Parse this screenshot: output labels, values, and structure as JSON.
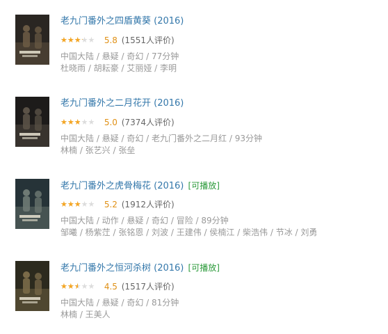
{
  "items": [
    {
      "title": "老九门番外之四盾黄葵 (2016)",
      "playable": "",
      "rating": 5.8,
      "rating_label": "5.8",
      "votes_label": "(1551人评价)",
      "meta": "中国大陆 / 悬疑 / 奇幻 / 77分钟",
      "cast": "杜晓雨 / 胡耘豪 / 艾丽娅 / 李明",
      "poster_palette": [
        "#2a2622",
        "#6a5a44"
      ]
    },
    {
      "title": "老九门番外之二月花开 (2016)",
      "playable": "",
      "rating": 5.0,
      "rating_label": "5.0",
      "votes_label": "(7374人评价)",
      "meta": "中国大陆 / 悬疑 / 奇幻 / 老九门番外之二月红 / 93分钟",
      "cast": "林楠 / 张艺兴 / 张垒",
      "poster_palette": [
        "#1d1b1a",
        "#5b5247"
      ]
    },
    {
      "title": "老九门番外之虎骨梅花 (2016)",
      "playable": "[可播放]",
      "rating": 5.2,
      "rating_label": "5.2",
      "votes_label": "(1912人评价)",
      "meta": "中国大陆 / 动作 / 悬疑 / 奇幻 / 冒险 / 89分钟",
      "cast": "邹曦 / 杨紫茳 / 张铭恩 / 刘波 / 王建伟 / 侯楠江 / 柴浩伟 / 节冰 / 刘勇",
      "poster_palette": [
        "#263338",
        "#6f7a74"
      ]
    },
    {
      "title": "老九门番外之恒河杀树 (2016)",
      "playable": "[可播放]",
      "rating": 4.5,
      "rating_label": "4.5",
      "votes_label": "(1517人评价)",
      "meta": "中国大陆 / 悬疑 / 奇幻 / 81分钟",
      "cast": "林楠 / 王美人",
      "poster_palette": [
        "#2c2a1e",
        "#7a6a48"
      ]
    }
  ],
  "colors": {
    "title": "#3377aa",
    "playable": "#2b9a3a",
    "star": "#f5a623",
    "score": "#e09015",
    "muted": "#999999"
  },
  "icons": {
    "rating": "star-icon"
  }
}
